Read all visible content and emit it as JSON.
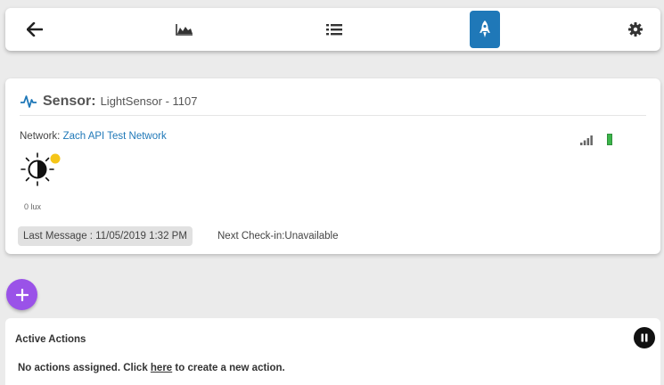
{
  "toolbar": {
    "buttons": [
      {
        "icon": "back-arrow-icon"
      },
      {
        "icon": "chart-icon"
      },
      {
        "icon": "list-icon"
      },
      {
        "icon": "rocket-icon",
        "active": true
      },
      {
        "icon": "gear-icon"
      }
    ],
    "active_color": "#1f78b8"
  },
  "sensor": {
    "label": "Sensor:",
    "name": "LightSensor - 1107",
    "network_label": "Network:",
    "network_name": "Zach API Test Network",
    "reading": "0 lux",
    "last_message": "Last Message : 11/05/2019 1:32 PM",
    "next_checkin": "Next Check-in:Unavailable",
    "status_dot_color": "#f5c518",
    "battery_color": "#3bb54a"
  },
  "fab": {
    "symbol": "+",
    "color": "#9a52e8"
  },
  "actions": {
    "title": "Active Actions",
    "empty_prefix": "No actions assigned. Click ",
    "empty_link": "here",
    "empty_suffix": " to create a new action."
  }
}
